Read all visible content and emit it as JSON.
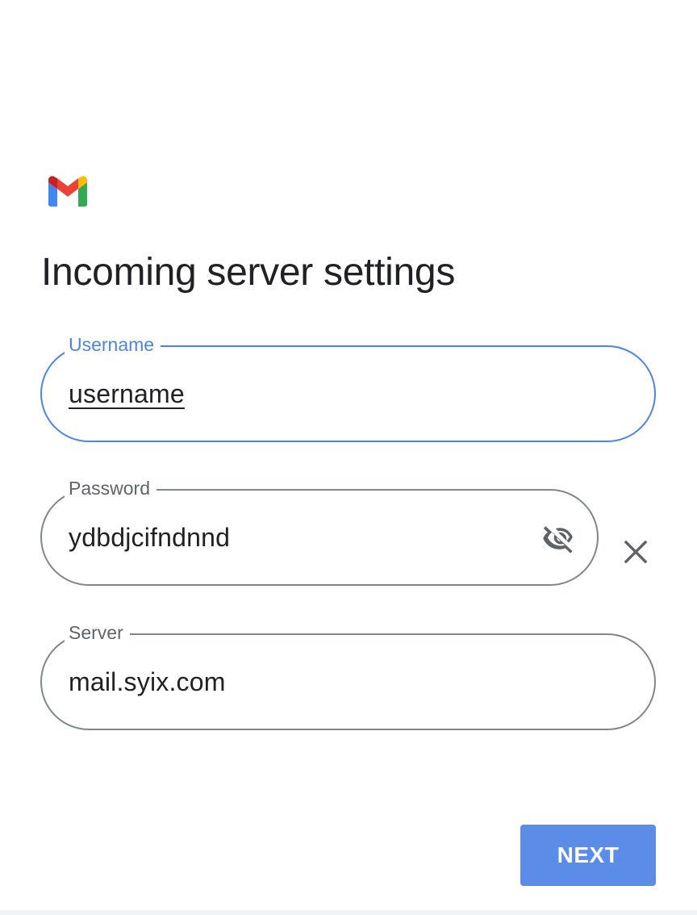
{
  "screen": {
    "title": "Incoming server settings"
  },
  "form": {
    "username": {
      "label": "Username",
      "value": "username",
      "focused": true
    },
    "password": {
      "label": "Password",
      "value": "ydbdjcifndnnd",
      "toggle_icon": "visibility-off-icon"
    },
    "server": {
      "label": "Server",
      "value": "mail.syix.com"
    }
  },
  "actions": {
    "clear_icon": "close-icon",
    "next_label": "NEXT"
  },
  "brand": {
    "logo": "gmail-logo",
    "colors": {
      "red": "#ea4335",
      "blue": "#4285f4",
      "green": "#34a853",
      "yellow": "#fbbc04",
      "dark_red": "#c5221f"
    }
  },
  "theme": {
    "accent": "#4e84e0",
    "button_bg": "#5b8de8",
    "outline": "#80868b",
    "text": "#202124",
    "label": "#5f6368"
  }
}
